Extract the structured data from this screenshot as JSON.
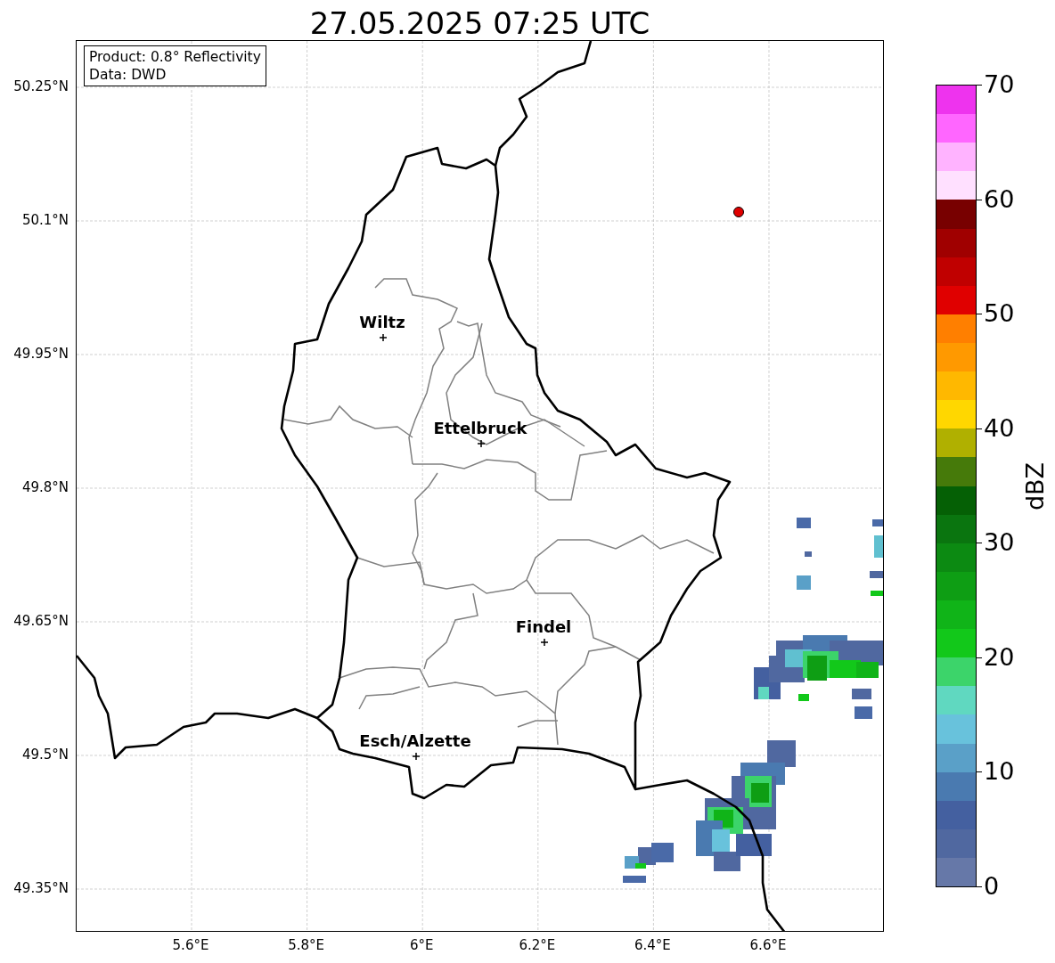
{
  "title": "27.05.2025 07:25 UTC",
  "info_box": [
    "Product: 0.8° Reflectivity",
    "Data: DWD"
  ],
  "map": {
    "cities": [
      {
        "name": "Wiltz"
      },
      {
        "name": "Ettelbruck"
      },
      {
        "name": "Findel"
      },
      {
        "name": "Esch/Alzette"
      }
    ],
    "lat_ticks": [
      "50.25°N",
      "50.1°N",
      "49.95°N",
      "49.8°N",
      "49.65°N",
      "49.5°N",
      "49.35°N"
    ],
    "lon_ticks": [
      "5.6°E",
      "5.8°E",
      "6°E",
      "6.2°E",
      "6.4°E",
      "6.6°E"
    ]
  },
  "colorbar": {
    "label": "dBZ",
    "ticks": [
      "70",
      "60",
      "50",
      "40",
      "30",
      "20",
      "10",
      "0"
    ],
    "segments": [
      {
        "color": "#ee33ee"
      },
      {
        "color": "#ff66ff"
      },
      {
        "color": "#ffb3ff"
      },
      {
        "color": "#ffe0ff"
      },
      {
        "color": "#780000"
      },
      {
        "color": "#a00000"
      },
      {
        "color": "#c00000"
      },
      {
        "color": "#e00000"
      },
      {
        "color": "#ff7f00"
      },
      {
        "color": "#ff9900"
      },
      {
        "color": "#ffb800"
      },
      {
        "color": "#ffd700"
      },
      {
        "color": "#b0b000"
      },
      {
        "color": "#467a0a"
      },
      {
        "color": "#056005"
      },
      {
        "color": "#0a750f"
      },
      {
        "color": "#0c8a12"
      },
      {
        "color": "#0e9e14"
      },
      {
        "color": "#10b418"
      },
      {
        "color": "#12c81a"
      },
      {
        "color": "#3cd46a"
      },
      {
        "color": "#60d8c0"
      },
      {
        "color": "#68c2dc"
      },
      {
        "color": "#5aa0c8"
      },
      {
        "color": "#4a7ab0"
      },
      {
        "color": "#4460a0"
      },
      {
        "color": "#5068a0"
      },
      {
        "color": "#6678a8"
      }
    ]
  }
}
